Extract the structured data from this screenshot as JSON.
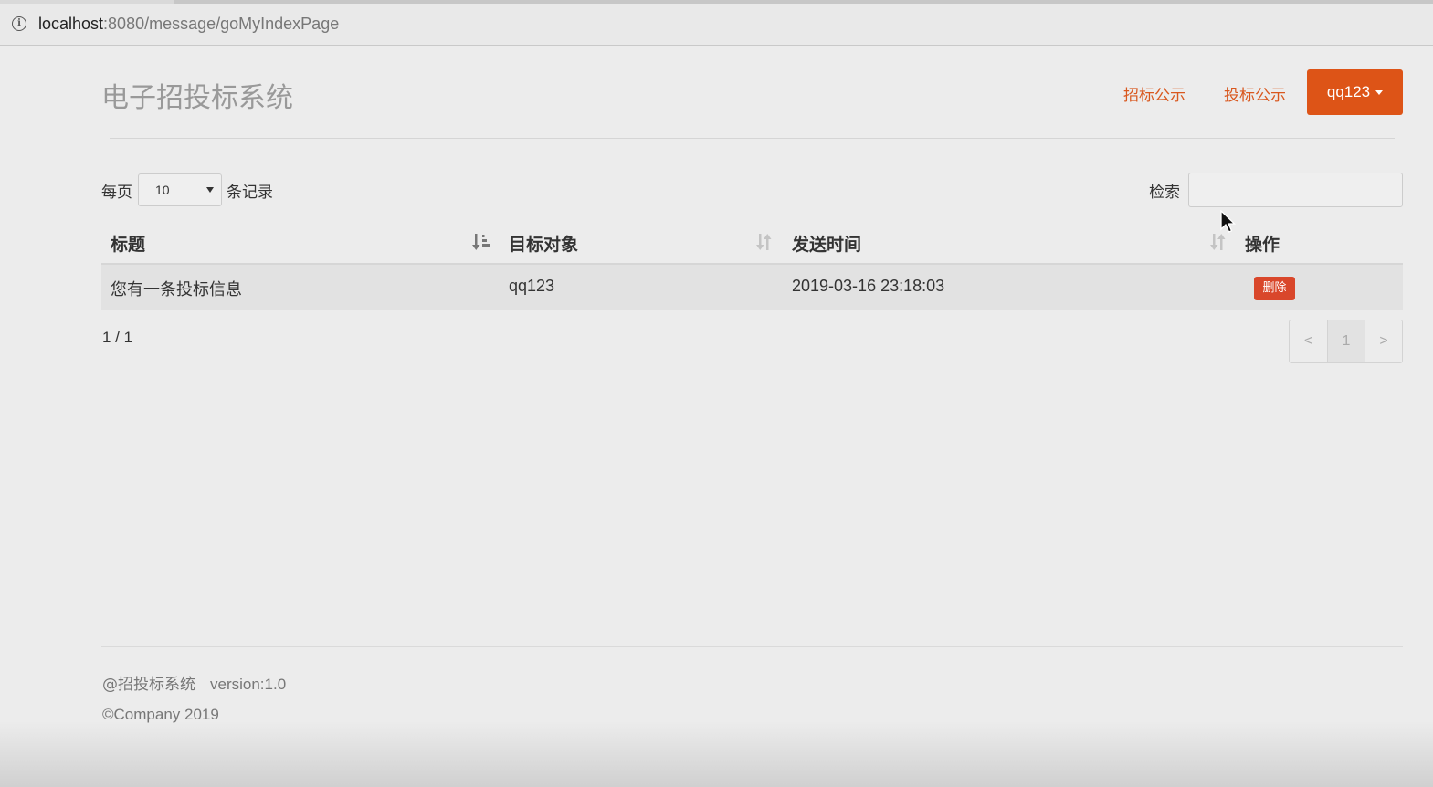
{
  "browser": {
    "url_host": "localhost",
    "url_rest": ":8080/message/goMyIndexPage"
  },
  "header": {
    "brand": "电子招投标系统",
    "nav": [
      "招标公示",
      "投标公示"
    ],
    "user_menu": "qq123"
  },
  "table_controls": {
    "length_prefix": "每页",
    "length_value": "10",
    "length_suffix": "条记录",
    "search_label": "检索",
    "search_value": ""
  },
  "table": {
    "columns": [
      "标题",
      "目标对象",
      "发送时间",
      "操作"
    ],
    "rows": [
      {
        "title": "您有一条投标信息",
        "target": "qq123",
        "time": "2019-03-16 23:18:03",
        "action": "删除"
      }
    ]
  },
  "paging": {
    "info": "1 / 1",
    "prev": "<",
    "current": "1",
    "next": ">"
  },
  "footer": {
    "system": "@招投标系统",
    "version": "version:1.0",
    "copyright": "©Company 2019"
  },
  "colors": {
    "accent": "#dd5417",
    "nav_link": "#d9581f",
    "delete_button": "#d9472b",
    "background": "#ececec"
  },
  "icons": [
    "info-icon",
    "sort-desc-icon",
    "sort-both-icon",
    "caret-down-icon",
    "mouse-cursor-icon"
  ]
}
